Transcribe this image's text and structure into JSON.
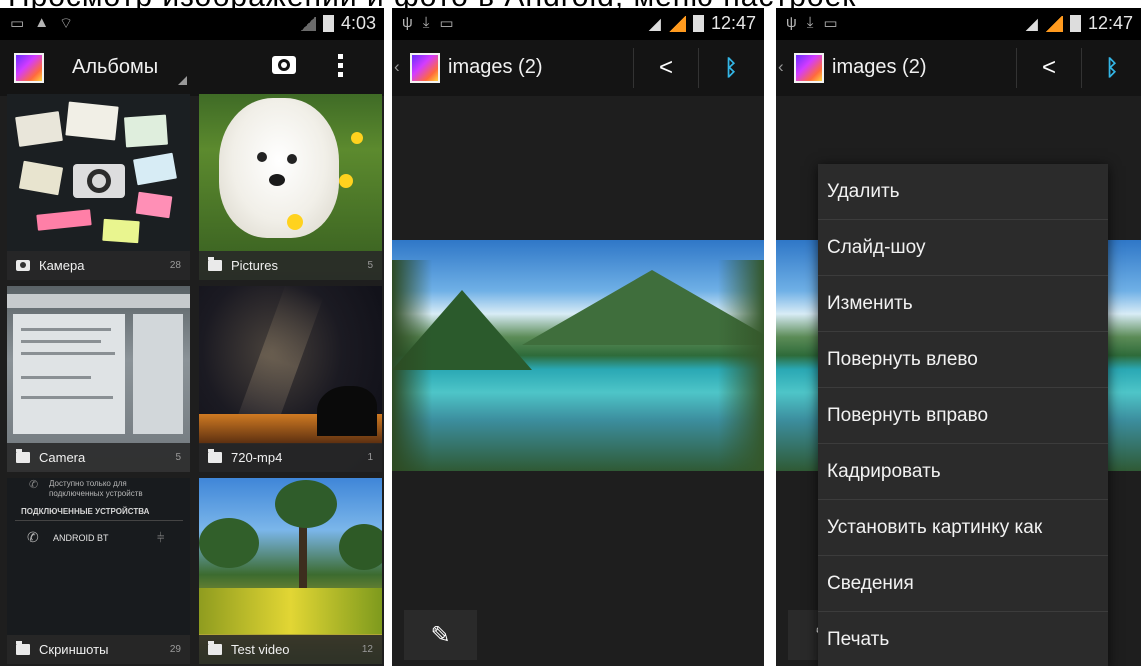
{
  "header_caption": "Просмотр изображений и фото в Android, меню настроек",
  "panel1": {
    "status": {
      "time": "4:03"
    },
    "actionbar": {
      "title": "Альбомы",
      "camera_icon": "camera-icon",
      "overflow_icon": "overflow-menu-icon"
    },
    "albums": [
      {
        "label": "Камера",
        "count": "28",
        "icon": "camera-small-icon"
      },
      {
        "label": "Pictures",
        "count": "5",
        "icon": "folder-icon"
      },
      {
        "label": "Camera",
        "count": "5",
        "icon": "folder-icon"
      },
      {
        "label": "720-mp4",
        "count": "1",
        "icon": "folder-icon"
      },
      {
        "label": "Скриншоты",
        "count": "29",
        "icon": "folder-icon"
      },
      {
        "label": "Test video",
        "count": "12",
        "icon": "folder-icon"
      }
    ],
    "bt_screenshot": {
      "line1": "Доступно только для",
      "line2": "подключенных устройств",
      "section": "ПОДКЛЮЧЕННЫЕ УСТРОЙСТВА",
      "device": "ANDROID BT"
    }
  },
  "panel2": {
    "status": {
      "time": "12:47"
    },
    "actionbar": {
      "title": "images (2)",
      "share_icon": "share-icon",
      "bluetooth_icon": "bluetooth-icon"
    },
    "edit_icon": "pencil-icon"
  },
  "panel3": {
    "status": {
      "time": "12:47"
    },
    "actionbar": {
      "title": "images (2)"
    },
    "menu": [
      "Удалить",
      "Слайд-шоу",
      "Изменить",
      "Повернуть влево",
      "Повернуть вправо",
      "Кадрировать",
      "Установить картинку как",
      "Сведения",
      "Печать"
    ]
  },
  "colors": {
    "accent_signal": "#ff9a1e",
    "bluetooth": "#33b5e5",
    "panel_bg": "#1e1e1e",
    "actionbar_bg": "#141414"
  }
}
